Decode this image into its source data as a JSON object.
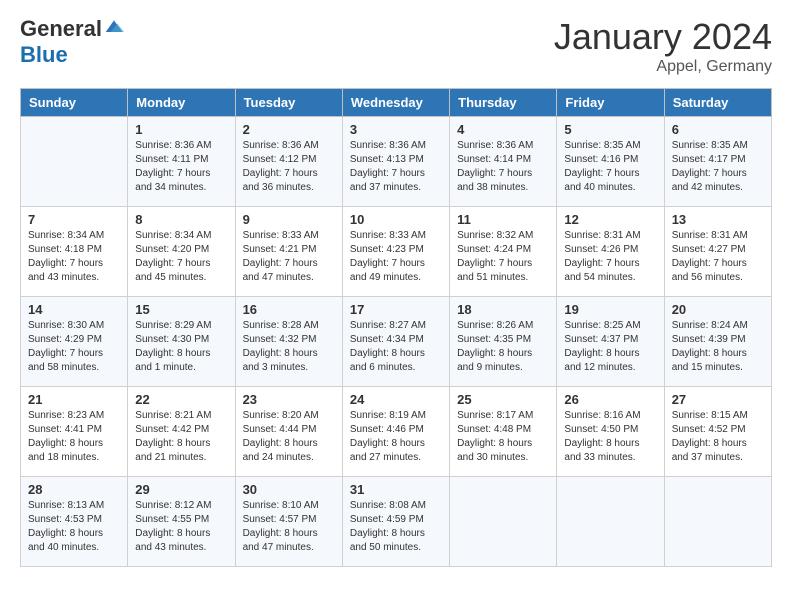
{
  "logo": {
    "general": "General",
    "blue": "Blue"
  },
  "title": "January 2024",
  "location": "Appel, Germany",
  "weekdays": [
    "Sunday",
    "Monday",
    "Tuesday",
    "Wednesday",
    "Thursday",
    "Friday",
    "Saturday"
  ],
  "weeks": [
    [
      {
        "day": "",
        "sunrise": "",
        "sunset": "",
        "daylight": ""
      },
      {
        "day": "1",
        "sunrise": "Sunrise: 8:36 AM",
        "sunset": "Sunset: 4:11 PM",
        "daylight": "Daylight: 7 hours and 34 minutes."
      },
      {
        "day": "2",
        "sunrise": "Sunrise: 8:36 AM",
        "sunset": "Sunset: 4:12 PM",
        "daylight": "Daylight: 7 hours and 36 minutes."
      },
      {
        "day": "3",
        "sunrise": "Sunrise: 8:36 AM",
        "sunset": "Sunset: 4:13 PM",
        "daylight": "Daylight: 7 hours and 37 minutes."
      },
      {
        "day": "4",
        "sunrise": "Sunrise: 8:36 AM",
        "sunset": "Sunset: 4:14 PM",
        "daylight": "Daylight: 7 hours and 38 minutes."
      },
      {
        "day": "5",
        "sunrise": "Sunrise: 8:35 AM",
        "sunset": "Sunset: 4:16 PM",
        "daylight": "Daylight: 7 hours and 40 minutes."
      },
      {
        "day": "6",
        "sunrise": "Sunrise: 8:35 AM",
        "sunset": "Sunset: 4:17 PM",
        "daylight": "Daylight: 7 hours and 42 minutes."
      }
    ],
    [
      {
        "day": "7",
        "sunrise": "Sunrise: 8:34 AM",
        "sunset": "Sunset: 4:18 PM",
        "daylight": "Daylight: 7 hours and 43 minutes."
      },
      {
        "day": "8",
        "sunrise": "Sunrise: 8:34 AM",
        "sunset": "Sunset: 4:20 PM",
        "daylight": "Daylight: 7 hours and 45 minutes."
      },
      {
        "day": "9",
        "sunrise": "Sunrise: 8:33 AM",
        "sunset": "Sunset: 4:21 PM",
        "daylight": "Daylight: 7 hours and 47 minutes."
      },
      {
        "day": "10",
        "sunrise": "Sunrise: 8:33 AM",
        "sunset": "Sunset: 4:23 PM",
        "daylight": "Daylight: 7 hours and 49 minutes."
      },
      {
        "day": "11",
        "sunrise": "Sunrise: 8:32 AM",
        "sunset": "Sunset: 4:24 PM",
        "daylight": "Daylight: 7 hours and 51 minutes."
      },
      {
        "day": "12",
        "sunrise": "Sunrise: 8:31 AM",
        "sunset": "Sunset: 4:26 PM",
        "daylight": "Daylight: 7 hours and 54 minutes."
      },
      {
        "day": "13",
        "sunrise": "Sunrise: 8:31 AM",
        "sunset": "Sunset: 4:27 PM",
        "daylight": "Daylight: 7 hours and 56 minutes."
      }
    ],
    [
      {
        "day": "14",
        "sunrise": "Sunrise: 8:30 AM",
        "sunset": "Sunset: 4:29 PM",
        "daylight": "Daylight: 7 hours and 58 minutes."
      },
      {
        "day": "15",
        "sunrise": "Sunrise: 8:29 AM",
        "sunset": "Sunset: 4:30 PM",
        "daylight": "Daylight: 8 hours and 1 minute."
      },
      {
        "day": "16",
        "sunrise": "Sunrise: 8:28 AM",
        "sunset": "Sunset: 4:32 PM",
        "daylight": "Daylight: 8 hours and 3 minutes."
      },
      {
        "day": "17",
        "sunrise": "Sunrise: 8:27 AM",
        "sunset": "Sunset: 4:34 PM",
        "daylight": "Daylight: 8 hours and 6 minutes."
      },
      {
        "day": "18",
        "sunrise": "Sunrise: 8:26 AM",
        "sunset": "Sunset: 4:35 PM",
        "daylight": "Daylight: 8 hours and 9 minutes."
      },
      {
        "day": "19",
        "sunrise": "Sunrise: 8:25 AM",
        "sunset": "Sunset: 4:37 PM",
        "daylight": "Daylight: 8 hours and 12 minutes."
      },
      {
        "day": "20",
        "sunrise": "Sunrise: 8:24 AM",
        "sunset": "Sunset: 4:39 PM",
        "daylight": "Daylight: 8 hours and 15 minutes."
      }
    ],
    [
      {
        "day": "21",
        "sunrise": "Sunrise: 8:23 AM",
        "sunset": "Sunset: 4:41 PM",
        "daylight": "Daylight: 8 hours and 18 minutes."
      },
      {
        "day": "22",
        "sunrise": "Sunrise: 8:21 AM",
        "sunset": "Sunset: 4:42 PM",
        "daylight": "Daylight: 8 hours and 21 minutes."
      },
      {
        "day": "23",
        "sunrise": "Sunrise: 8:20 AM",
        "sunset": "Sunset: 4:44 PM",
        "daylight": "Daylight: 8 hours and 24 minutes."
      },
      {
        "day": "24",
        "sunrise": "Sunrise: 8:19 AM",
        "sunset": "Sunset: 4:46 PM",
        "daylight": "Daylight: 8 hours and 27 minutes."
      },
      {
        "day": "25",
        "sunrise": "Sunrise: 8:17 AM",
        "sunset": "Sunset: 4:48 PM",
        "daylight": "Daylight: 8 hours and 30 minutes."
      },
      {
        "day": "26",
        "sunrise": "Sunrise: 8:16 AM",
        "sunset": "Sunset: 4:50 PM",
        "daylight": "Daylight: 8 hours and 33 minutes."
      },
      {
        "day": "27",
        "sunrise": "Sunrise: 8:15 AM",
        "sunset": "Sunset: 4:52 PM",
        "daylight": "Daylight: 8 hours and 37 minutes."
      }
    ],
    [
      {
        "day": "28",
        "sunrise": "Sunrise: 8:13 AM",
        "sunset": "Sunset: 4:53 PM",
        "daylight": "Daylight: 8 hours and 40 minutes."
      },
      {
        "day": "29",
        "sunrise": "Sunrise: 8:12 AM",
        "sunset": "Sunset: 4:55 PM",
        "daylight": "Daylight: 8 hours and 43 minutes."
      },
      {
        "day": "30",
        "sunrise": "Sunrise: 8:10 AM",
        "sunset": "Sunset: 4:57 PM",
        "daylight": "Daylight: 8 hours and 47 minutes."
      },
      {
        "day": "31",
        "sunrise": "Sunrise: 8:08 AM",
        "sunset": "Sunset: 4:59 PM",
        "daylight": "Daylight: 8 hours and 50 minutes."
      },
      {
        "day": "",
        "sunrise": "",
        "sunset": "",
        "daylight": ""
      },
      {
        "day": "",
        "sunrise": "",
        "sunset": "",
        "daylight": ""
      },
      {
        "day": "",
        "sunrise": "",
        "sunset": "",
        "daylight": ""
      }
    ]
  ]
}
